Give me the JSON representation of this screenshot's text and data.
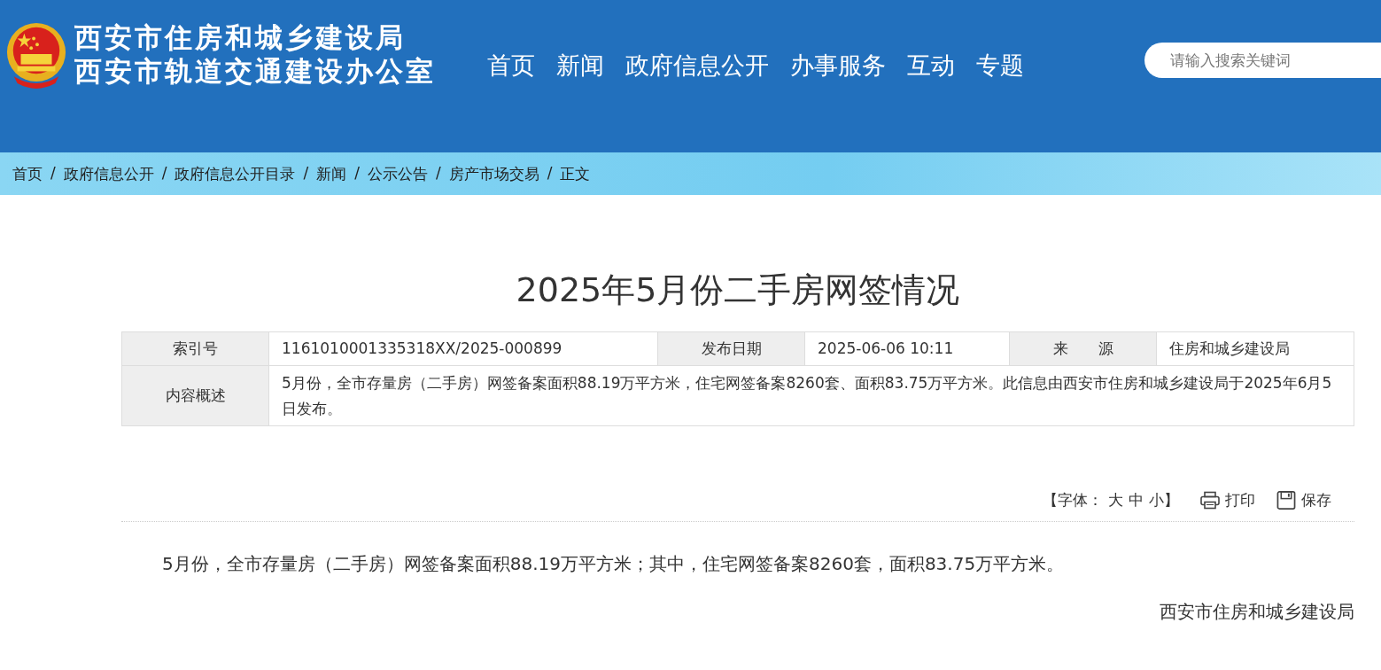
{
  "header": {
    "titles": [
      "西安市住房和城乡建设局",
      "西安市轨道交通建设办公室"
    ],
    "nav": [
      "首页",
      "新闻",
      "政府信息公开",
      "办事服务",
      "互动",
      "专题"
    ],
    "search": {
      "placeholder": "请输入搜索关键词"
    }
  },
  "breadcrumb": {
    "separator": "/",
    "items": [
      "首页",
      "政府信息公开",
      "政府信息公开目录",
      "新闻",
      "公示公告",
      "房产市场交易",
      "正文"
    ]
  },
  "article": {
    "title": "2025年5月份二手房网签情况",
    "meta": [
      {
        "label": "索引号",
        "value": "1161010001335318XX/2025-000899"
      },
      {
        "label": "发布日期",
        "value": "2025-06-06 10:11"
      },
      {
        "label": "来　　源",
        "value": "住房和城乡建设局"
      }
    ],
    "summary": {
      "label": "内容概述",
      "value": "5月份，全市存量房（二手房）网签备案面积88.19万平方米，住宅网签备案8260套、面积83.75万平方米。此信息由西安市住房和城乡建设局于2025年6月5日发布。"
    },
    "font_size": {
      "open": "【字体：",
      "options": [
        "大",
        "中",
        "小"
      ],
      "close": "】"
    },
    "actions": [
      {
        "kind": "print",
        "label": "打印"
      },
      {
        "kind": "save",
        "label": "保存"
      }
    ],
    "body": "5月份，全市存量房（二手房）网签备案面积88.19万平方米；其中，住宅网签备案8260套，面积83.75万平方米。",
    "signature": "西安市住房和城乡建设局"
  }
}
